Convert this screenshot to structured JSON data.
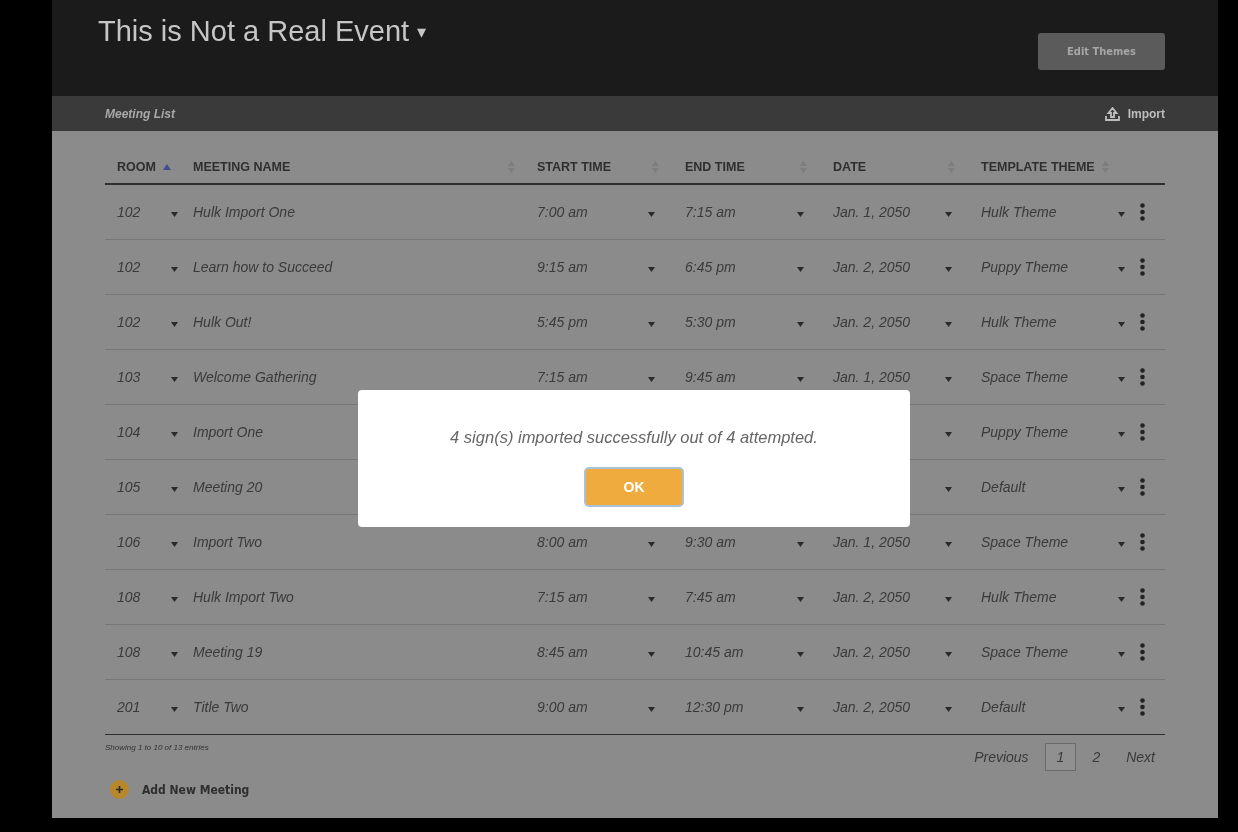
{
  "header": {
    "title": "This is Not a Real Event",
    "title_caret": "▾",
    "edit_button": "Edit Themes"
  },
  "subbar": {
    "title": "Meeting List",
    "import": "Import"
  },
  "table": {
    "columns": [
      {
        "label": "ROOM",
        "sorted": true
      },
      {
        "label": "MEETING NAME",
        "sorted": false
      },
      {
        "label": "START TIME",
        "sorted": false
      },
      {
        "label": "END TIME",
        "sorted": false
      },
      {
        "label": "DATE",
        "sorted": false
      },
      {
        "label": "TEMPLATE THEME",
        "sorted": false
      }
    ],
    "rows": [
      {
        "room": "102",
        "name": "Hulk Import One",
        "start": "7:00 am",
        "end": "7:15 am",
        "date": "Jan. 1, 2050",
        "theme": "Hulk Theme"
      },
      {
        "room": "102",
        "name": "Learn how to Succeed",
        "start": "9:15 am",
        "end": "6:45 pm",
        "date": "Jan. 2, 2050",
        "theme": "Puppy Theme"
      },
      {
        "room": "102",
        "name": "Hulk Out!",
        "start": "5:45 pm",
        "end": "5:30 pm",
        "date": "Jan. 2, 2050",
        "theme": "Hulk Theme"
      },
      {
        "room": "103",
        "name": "Welcome Gathering",
        "start": "7:15 am",
        "end": "9:45 am",
        "date": "Jan. 1, 2050",
        "theme": "Space Theme"
      },
      {
        "room": "104",
        "name": "Import One",
        "theme": "Puppy Theme"
      },
      {
        "room": "105",
        "name": "Meeting 20",
        "theme": "Default"
      },
      {
        "room": "106",
        "name": "Import Two",
        "start": "8:00 am",
        "end": "9:30 am",
        "date": "Jan. 1, 2050",
        "theme": "Space Theme"
      },
      {
        "room": "108",
        "name": "Hulk Import Two",
        "start": "7:15 am",
        "end": "7:45 am",
        "date": "Jan. 2, 2050",
        "theme": "Hulk Theme"
      },
      {
        "room": "108",
        "name": "Meeting 19",
        "start": "8:45 am",
        "end": "10:45 am",
        "date": "Jan. 2, 2050",
        "theme": "Space Theme"
      },
      {
        "room": "201",
        "name": "Title Two",
        "start": "9:00 am",
        "end": "12:30 pm",
        "date": "Jan. 2, 2050",
        "theme": "Default"
      }
    ]
  },
  "footer": {
    "info": "Showing 1 to 10 of 13 entries",
    "previous": "Previous",
    "pages": [
      {
        "label": "1",
        "selected": true
      },
      {
        "label": "2",
        "selected": false
      }
    ],
    "next": "Next",
    "add": "Add New Meeting"
  },
  "dialog": {
    "message": "4 sign(s) imported successfully out of 4 attempted.",
    "ok": "OK"
  }
}
